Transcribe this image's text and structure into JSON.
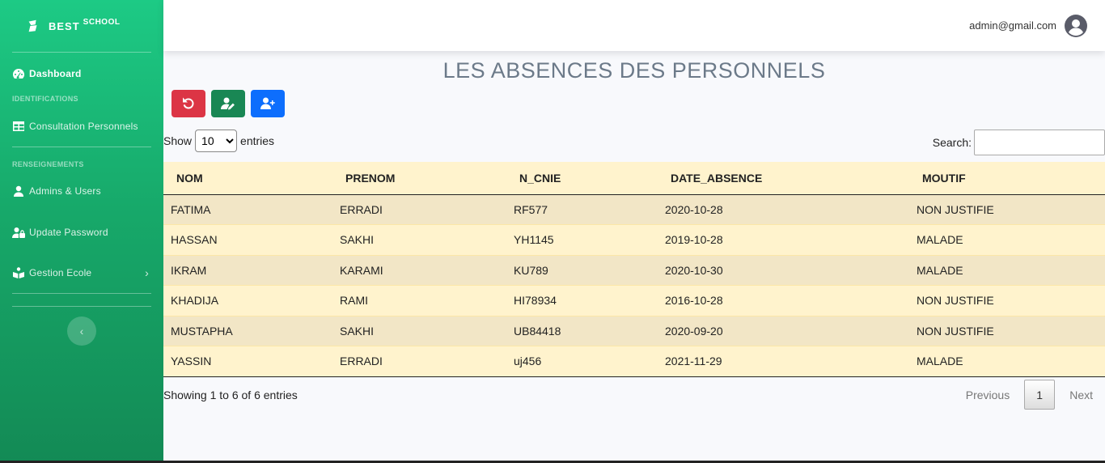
{
  "brand": {
    "name": "BEST",
    "sup": "SCHOOL"
  },
  "sidebar": {
    "dashboard": "Dashboard",
    "heading_identifications": "IDENTIFICATIONS",
    "consultation": "Consultation Personnels",
    "heading_renseignements": "RENSEIGNEMENTS",
    "admins": "Admins & Users",
    "update_password": "Update Password",
    "gestion_ecole": "Gestion Ecole",
    "toggle_icon": "chevron-left-icon"
  },
  "topbar": {
    "email": "admin@gmail.com"
  },
  "page": {
    "title": "LES ABSENCES DES PERSONNELS"
  },
  "buttons": {
    "reset": {
      "icon": "undo-icon",
      "color": "#dc3545"
    },
    "edit_user": {
      "icon": "user-edit-icon",
      "color": "#198754"
    },
    "add_user": {
      "icon": "user-plus-icon",
      "color": "#0d6efd"
    }
  },
  "controls": {
    "show_label": "Show",
    "entries_label": "entries",
    "page_size": "10",
    "search_label": "Search:",
    "search_value": ""
  },
  "table": {
    "columns": [
      "NOM",
      "PRENOM",
      "N_CNIE",
      "DATE_ABSENCE",
      "MOUTIF"
    ],
    "rows": [
      [
        "FATIMA",
        "ERRADI",
        "RF577",
        "2020-10-28",
        "NON JUSTIFIE"
      ],
      [
        "HASSAN",
        "SAKHI",
        "YH1145",
        "2019-10-28",
        "MALADE"
      ],
      [
        "IKRAM",
        "KARAMI",
        "KU789",
        "2020-10-30",
        "MALADE"
      ],
      [
        "KHADIJA",
        "RAMI",
        "HI78934",
        "2016-10-28",
        "NON JUSTIFIE"
      ],
      [
        "MUSTAPHA",
        "SAKHI",
        "UB84418",
        "2020-09-20",
        "NON JUSTIFIE"
      ],
      [
        "YASSIN",
        "ERRADI",
        "uj456",
        "2021-11-29",
        "MALADE"
      ]
    ]
  },
  "footer": {
    "info": "Showing 1 to 6 of 6 entries",
    "previous": "Previous",
    "current_page": "1",
    "next": "Next"
  }
}
